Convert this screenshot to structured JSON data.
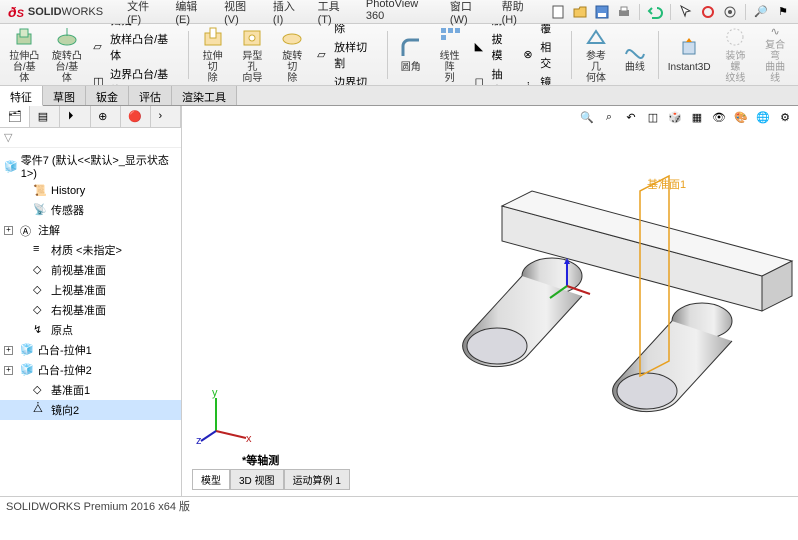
{
  "app": {
    "logo_letter": "S",
    "logo_text_solid": "SOLID",
    "logo_text_works": "WORKS"
  },
  "menus": [
    "文件(F)",
    "编辑(E)",
    "视图(V)",
    "插入(I)",
    "工具(T)",
    "PhotoView 360",
    "窗口(W)",
    "帮助(H)"
  ],
  "ribbon": {
    "extrude": "拉伸凸\n台/基体",
    "revolve": "旋转凸\n台/基体",
    "sweep": "扫描",
    "loft": "放样凸台/基体",
    "boundary": "边界凸台/基体",
    "extcut": "拉伸切\n除",
    "hole": "异型孔\n向导",
    "revcut": "旋转切\n除",
    "sweepcut": "扫描切除",
    "loftcut": "放样切割",
    "boundcut": "边界切除",
    "fillet": "圆角",
    "linpat": "线性阵\n列",
    "rib": "筋",
    "draft": "拔模",
    "shell": "抽壳",
    "wrap": "包覆",
    "intersect": "相交",
    "mirror": "镜向",
    "refgeom": "参考几\n何体",
    "curves": "曲线",
    "instant3d": "Instant3D",
    "thread": "装饰螺\n纹线",
    "compcurve": "复合弯\n曲曲线"
  },
  "tabs": [
    "特征",
    "草图",
    "钣金",
    "评估",
    "渲染工具"
  ],
  "tree": {
    "root": "零件7 (默认<<默认>_显示状态 1>)",
    "items": [
      {
        "label": "History",
        "ico": "history"
      },
      {
        "label": "传感器",
        "ico": "sensor"
      },
      {
        "label": "注解",
        "ico": "annotation",
        "expandable": true
      },
      {
        "label": "材质 <未指定>",
        "ico": "material"
      },
      {
        "label": "前视基准面",
        "ico": "plane"
      },
      {
        "label": "上视基准面",
        "ico": "plane"
      },
      {
        "label": "右视基准面",
        "ico": "plane"
      },
      {
        "label": "原点",
        "ico": "origin"
      },
      {
        "label": "凸台-拉伸1",
        "ico": "feature",
        "expandable": true
      },
      {
        "label": "凸台-拉伸2",
        "ico": "feature",
        "expandable": true
      },
      {
        "label": "基准面1",
        "ico": "plane"
      },
      {
        "label": "镜向2",
        "ico": "mirror",
        "selected": true
      }
    ]
  },
  "viewport": {
    "iso_label": "*等轴测",
    "mirror_plane_label": "基准面1"
  },
  "bottom_tabs": [
    "模型",
    "3D 视图",
    "运动算例 1"
  ],
  "status": "SOLIDWORKS Premium 2016 x64 版"
}
